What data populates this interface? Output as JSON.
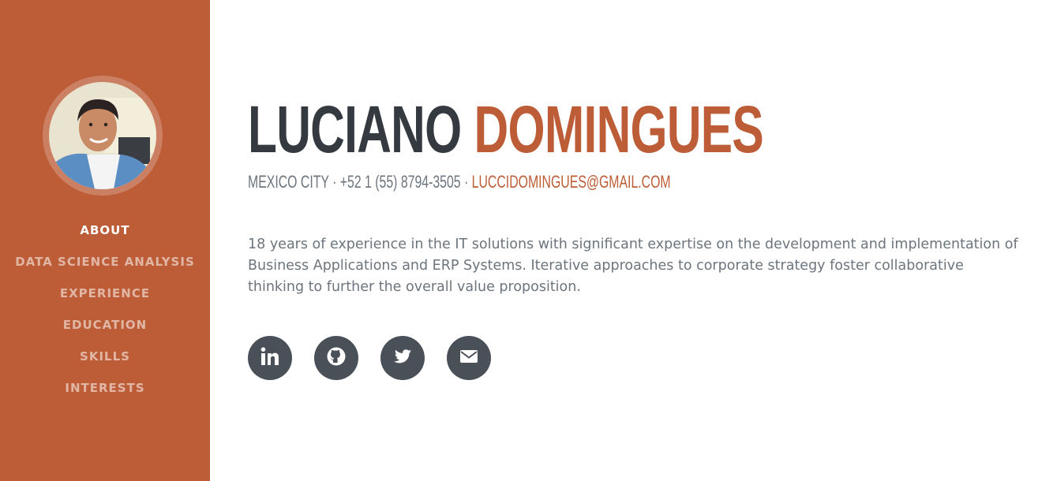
{
  "profile": {
    "first_name": "LUCIANO",
    "last_name": "DOMINGUES",
    "location": "MEXICO CITY",
    "separator": " · ",
    "phone": "+52 1 (55) 8794-3505",
    "email": "LUCCIDOMINGUES@GMAIL.COM",
    "summary": "18 years of experience in the IT solutions with significant expertise on the development and implementation of Business Applications and ERP Systems. Iterative approaches to corporate strategy foster collaborative thinking to further the overall value proposition."
  },
  "nav": {
    "items": [
      {
        "label": "ABOUT",
        "active": true
      },
      {
        "label": "DATA SCIENCE ANALYSIS",
        "active": false
      },
      {
        "label": "EXPERIENCE",
        "active": false
      },
      {
        "label": "EDUCATION",
        "active": false
      },
      {
        "label": "SKILLS",
        "active": false
      },
      {
        "label": "INTERESTS",
        "active": false
      }
    ]
  },
  "socials": [
    {
      "icon": "linkedin-icon"
    },
    {
      "icon": "github-icon"
    },
    {
      "icon": "twitter-icon"
    },
    {
      "icon": "envelope-icon"
    }
  ],
  "colors": {
    "primary": "#bd5d38",
    "dark": "#343a40",
    "muted": "#6c757d",
    "social_bg": "#495057"
  }
}
